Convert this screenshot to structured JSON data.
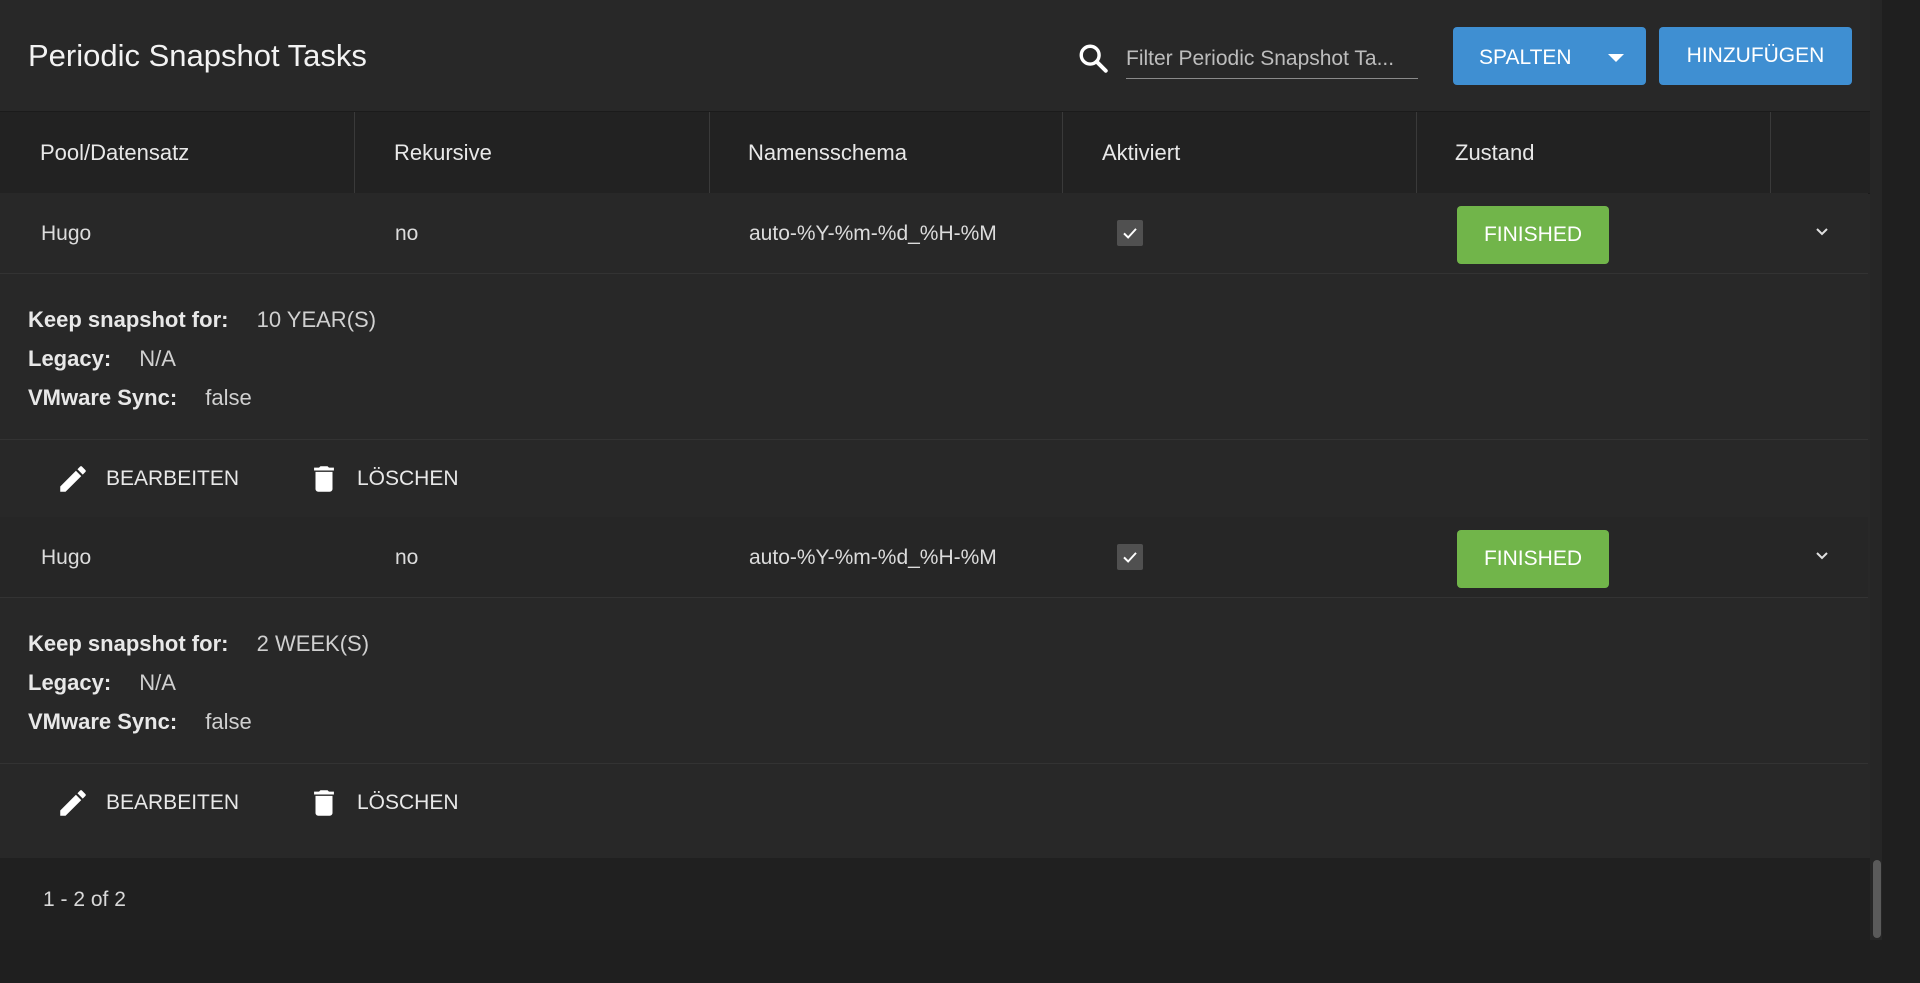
{
  "header": {
    "title": "Periodic Snapshot Tasks",
    "search_placeholder": "Filter Periodic Snapshot Ta...",
    "columns_button": "SPALTEN",
    "add_button": "HINZUFÜGEN"
  },
  "columns": [
    "Pool/Datensatz",
    "Rekursive",
    "Namensschema",
    "Aktiviert",
    "Zustand"
  ],
  "rows": [
    {
      "dataset": "Hugo",
      "recursive": "no",
      "naming_schema": "auto-%Y-%m-%d_%H-%M",
      "enabled": true,
      "state": "FINISHED",
      "details": {
        "keep_label": "Keep snapshot for:",
        "keep_value": "10 YEAR(S)",
        "legacy_label": "Legacy:",
        "legacy_value": "N/A",
        "vmware_label": "VMware Sync:",
        "vmware_value": "false"
      },
      "edit_label": "BEARBEITEN",
      "delete_label": "LÖSCHEN"
    },
    {
      "dataset": "Hugo",
      "recursive": "no",
      "naming_schema": "auto-%Y-%m-%d_%H-%M",
      "enabled": true,
      "state": "FINISHED",
      "details": {
        "keep_label": "Keep snapshot for:",
        "keep_value": "2 WEEK(S)",
        "legacy_label": "Legacy:",
        "legacy_value": "N/A",
        "vmware_label": "VMware Sync:",
        "vmware_value": "false"
      },
      "edit_label": "BEARBEITEN",
      "delete_label": "LÖSCHEN"
    }
  ],
  "footer": {
    "pagination": "1 - 2 of 2"
  },
  "colors": {
    "primary": "#3f8fd2",
    "status_finished": "#71b54a",
    "background": "#282828"
  },
  "icons": [
    "search-icon",
    "caret-down-icon",
    "checkmark-icon",
    "chevron-down-icon",
    "pencil-icon",
    "trash-icon"
  ]
}
